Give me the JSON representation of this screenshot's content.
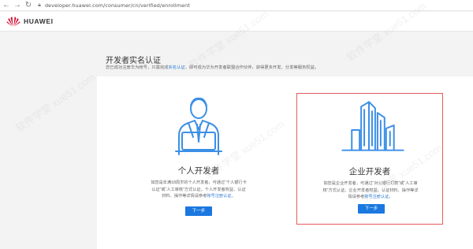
{
  "browser": {
    "url": "developer.huawei.com/consumer/cn/verified/enrollment"
  },
  "header": {
    "brand": "HUAWEI"
  },
  "page": {
    "title": "开发者实名认证",
    "subtitle_before": "您已成功注册华为帐号，只需完成",
    "subtitle_link": "实名认证",
    "subtitle_after": "，即可成为华为开发者联盟合作伙伴，获得更多开发、分发等服务权益。"
  },
  "cards": {
    "personal": {
      "title": "个人开发者",
      "desc_line1": "如您是年满18周岁的个人开发者，可通过“个人银行卡",
      "desc_line2": "认证”或“人工审核”方式认证。个人开发者权益、认证",
      "desc_line3_before": "材料、操作等详情请参考",
      "desc_link": "帐号注册认证",
      "desc_line3_after": "。",
      "button": "下一步"
    },
    "enterprise": {
      "title": "企业开发者",
      "desc_line1": "如您是企业开发者，可通过“对公银行打款”或“人工审",
      "desc_line2": "核”方式认证。企业开发者权益、认证材料、操作等详",
      "desc_line3_before": "情请参考",
      "desc_link": "帐号注册认证",
      "desc_line3_after": "。",
      "button": "下一步"
    }
  },
  "watermark": {
    "text": "软件学堂 xue51.com"
  },
  "colors": {
    "accent": "#1a78e0",
    "link": "#2e7bd6",
    "icon_stroke": "#3c8fe6",
    "highlight_border": "#e85a5a",
    "brand_red": "#cf0a2c"
  },
  "icons": {
    "back": "back-arrow-icon",
    "forward": "forward-arrow-icon",
    "reload": "reload-icon",
    "lock": "lock-icon",
    "personal": "businessman-laptop-icon",
    "enterprise": "office-buildings-icon"
  }
}
